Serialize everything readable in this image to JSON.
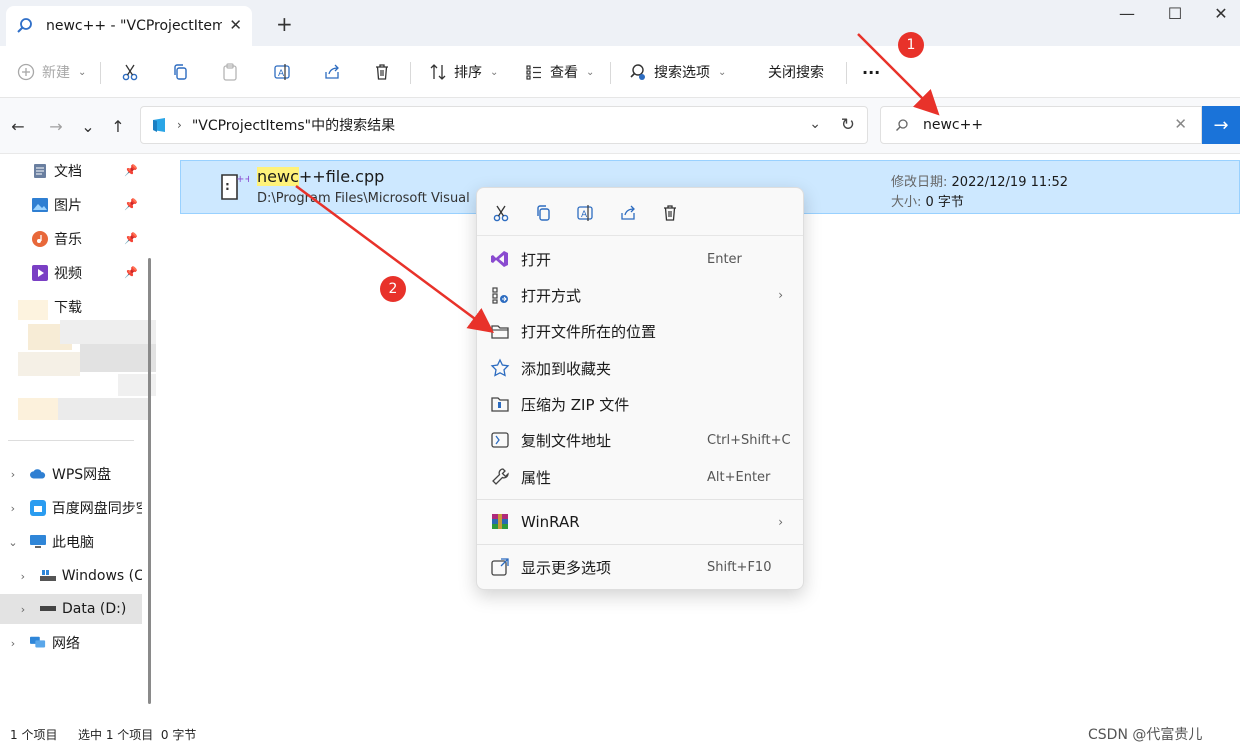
{
  "window": {
    "tab_title": "newc++ - \"VCProjectItems\"",
    "tab_close_glyph": "✕",
    "new_tab_glyph": "+",
    "minimize_glyph": "—",
    "maximize_glyph": "☐",
    "close_glyph": "✕"
  },
  "toolbar": {
    "new_label": "新建",
    "sort_label": "排序",
    "view_label": "查看",
    "search_options_label": "搜索选项",
    "close_search_label": "关闭搜索",
    "more_glyph": "···"
  },
  "navigation": {
    "back_glyph": "←",
    "forward_glyph": "→",
    "recent_glyph": "⌄",
    "up_glyph": "↑",
    "crumb_sep": "›",
    "address_text": "\"VCProjectItems\"中的搜索结果",
    "dropdown_glyph": "⌄",
    "refresh_glyph": "↻",
    "search_value": "newc++",
    "search_clear_glyph": "✕",
    "search_go_glyph": "→"
  },
  "sidebar": {
    "pinned": [
      {
        "label": "文档",
        "icon": "document-icon"
      },
      {
        "label": "图片",
        "icon": "picture-icon"
      },
      {
        "label": "音乐",
        "icon": "music-icon"
      },
      {
        "label": "视频",
        "icon": "video-icon"
      },
      {
        "label": "下载",
        "icon": "download-icon"
      }
    ],
    "pin_glyph": "📌",
    "tree": [
      {
        "label": "WPS网盘",
        "icon": "cloud-icon",
        "expander": "›"
      },
      {
        "label": "百度网盘同步空",
        "icon": "baidu-icon",
        "expander": "›"
      },
      {
        "label": "此电脑",
        "icon": "computer-icon",
        "expander": "⌄"
      },
      {
        "label": "Windows (C:)",
        "icon": "drive-icon",
        "expander": "›"
      },
      {
        "label": "Data (D:)",
        "icon": "drive-icon",
        "expander": "›"
      },
      {
        "label": "网络",
        "icon": "network-icon",
        "expander": "›"
      }
    ]
  },
  "file": {
    "name_highlight": "newc",
    "name_rest": "++file.cpp",
    "path": "D:\\Program Files\\Microsoft Visual",
    "modified_label": "修改日期:",
    "modified_value": "2022/12/19 11:52",
    "size_label": "大小:",
    "size_value": "0 字节"
  },
  "context_menu": {
    "items": [
      {
        "label": "打开",
        "shortcut": "Enter",
        "icon": "visual-studio-icon"
      },
      {
        "label": "打开方式",
        "shortcut": "",
        "icon": "open-with-icon",
        "submenu": "›"
      },
      {
        "label": "打开文件所在的位置",
        "shortcut": "",
        "icon": "folder-open-icon"
      },
      {
        "label": "添加到收藏夹",
        "shortcut": "",
        "icon": "star-icon"
      },
      {
        "label": "压缩为 ZIP 文件",
        "shortcut": "",
        "icon": "zip-icon"
      },
      {
        "label": "复制文件地址",
        "shortcut": "Ctrl+Shift+C",
        "icon": "copy-path-icon"
      },
      {
        "label": "属性",
        "shortcut": "Alt+Enter",
        "icon": "wrench-icon"
      },
      {
        "label": "WinRAR",
        "shortcut": "",
        "icon": "winrar-icon",
        "submenu": "›"
      },
      {
        "label": "显示更多选项",
        "shortcut": "Shift+F10",
        "icon": "more-options-icon"
      }
    ]
  },
  "status": {
    "count": "1 个项目",
    "selected": "选中 1 个项目  0 字节",
    "watermark": "CSDN @代富贵儿"
  },
  "annotations": {
    "badge1": "1",
    "badge2": "2",
    "color": "#e8322a"
  },
  "colors": {
    "accent": "#1a73d9",
    "selection": "#cde8ff",
    "highlight": "#fff27a"
  }
}
